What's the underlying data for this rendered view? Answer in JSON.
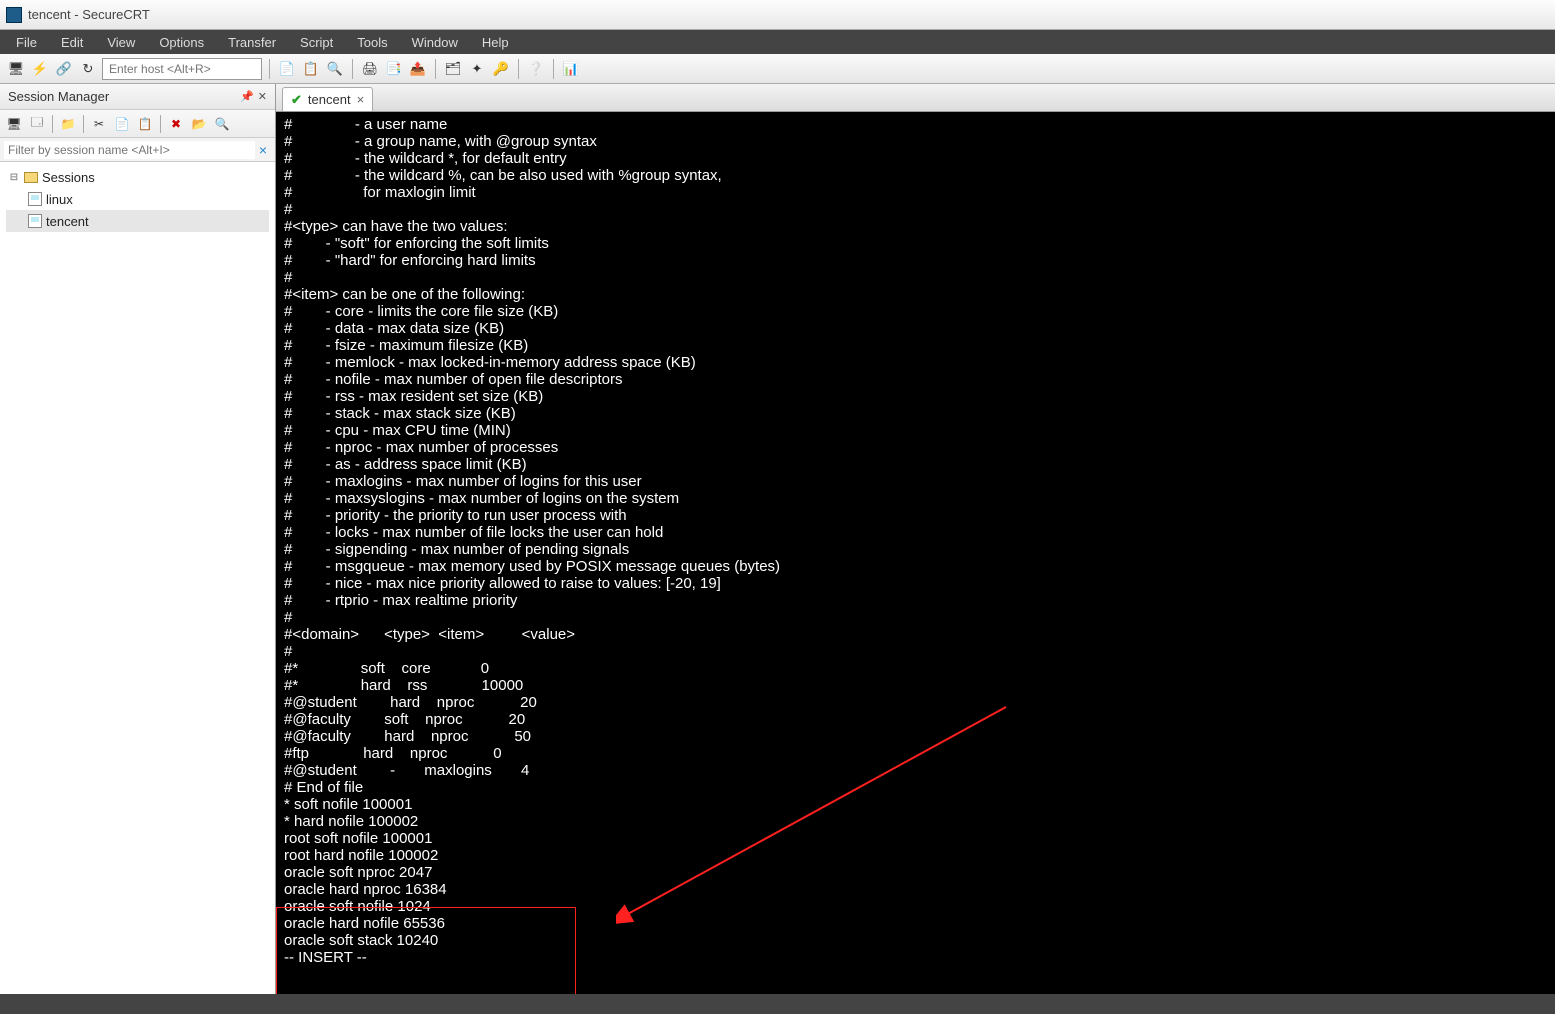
{
  "window": {
    "title": "tencent - SecureCRT"
  },
  "menu": {
    "items": [
      "File",
      "Edit",
      "View",
      "Options",
      "Transfer",
      "Script",
      "Tools",
      "Window",
      "Help"
    ]
  },
  "toolbar": {
    "host_placeholder": "Enter host <Alt+R>"
  },
  "session_manager": {
    "title": "Session Manager",
    "filter_placeholder": "Filter by session name <Alt+I>",
    "root": "Sessions",
    "items": [
      "linux",
      "tencent"
    ],
    "selected": "tencent"
  },
  "tab": {
    "name": "tencent"
  },
  "terminal_lines": [
    "#               - a user name",
    "#               - a group name, with @group syntax",
    "#               - the wildcard *, for default entry",
    "#               - the wildcard %, can be also used with %group syntax,",
    "#                 for maxlogin limit",
    "#",
    "#<type> can have the two values:",
    "#        - \"soft\" for enforcing the soft limits",
    "#        - \"hard\" for enforcing hard limits",
    "#",
    "#<item> can be one of the following:",
    "#        - core - limits the core file size (KB)",
    "#        - data - max data size (KB)",
    "#        - fsize - maximum filesize (KB)",
    "#        - memlock - max locked-in-memory address space (KB)",
    "#        - nofile - max number of open file descriptors",
    "#        - rss - max resident set size (KB)",
    "#        - stack - max stack size (KB)",
    "#        - cpu - max CPU time (MIN)",
    "#        - nproc - max number of processes",
    "#        - as - address space limit (KB)",
    "#        - maxlogins - max number of logins for this user",
    "#        - maxsyslogins - max number of logins on the system",
    "#        - priority - the priority to run user process with",
    "#        - locks - max number of file locks the user can hold",
    "#        - sigpending - max number of pending signals",
    "#        - msgqueue - max memory used by POSIX message queues (bytes)",
    "#        - nice - max nice priority allowed to raise to values: [-20, 19]",
    "#        - rtprio - max realtime priority",
    "#",
    "#<domain>      <type>  <item>         <value>",
    "#",
    "",
    "#*               soft    core            0",
    "#*               hard    rss             10000",
    "#@student        hard    nproc           20",
    "#@faculty        soft    nproc           20",
    "#@faculty        hard    nproc           50",
    "#ftp             hard    nproc           0",
    "#@student        -       maxlogins       4",
    "",
    "# End of file",
    "* soft nofile 100001",
    "* hard nofile 100002",
    "root soft nofile 100001",
    "root hard nofile 100002",
    "",
    "oracle soft nproc 2047",
    "oracle hard nproc 16384",
    "oracle soft nofile 1024",
    "oracle hard nofile 65536",
    "oracle soft stack 10240",
    "-- INSERT --"
  ],
  "status": {
    "right": ""
  }
}
